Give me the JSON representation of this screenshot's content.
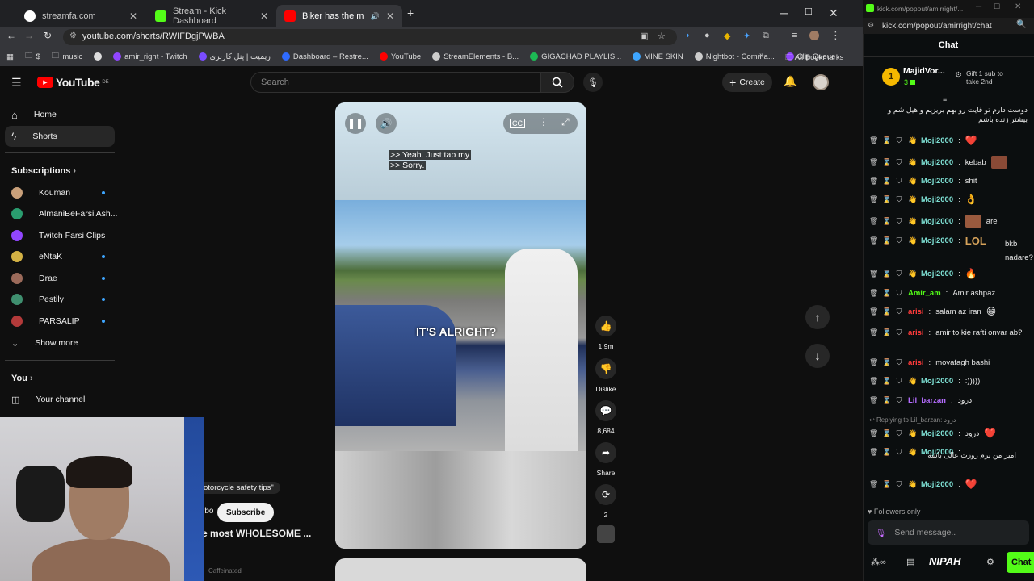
{
  "browser": {
    "tabs": [
      {
        "title": "streamfa.com",
        "favicon_color": "#4285f4"
      },
      {
        "title": "Stream - Kick Dashboard",
        "favicon_color": "#53fc18"
      },
      {
        "title": "Biker has the most WHOLE",
        "favicon_color": "#ff0000"
      }
    ],
    "url": "youtube.com/shorts/RWIFDgjPWBA",
    "bookmarks": [
      {
        "label": "$",
        "color": "#888"
      },
      {
        "label": "music",
        "color": "#888"
      },
      {
        "label": "amir_right - Twitch",
        "color": "#9146ff"
      },
      {
        "label": "ریمیت | پنل کاربری",
        "color": "#7a4cff"
      },
      {
        "label": "Dashboard – Restre...",
        "color": "#2f6bff"
      },
      {
        "label": "YouTube",
        "color": "#ff0000"
      },
      {
        "label": "StreamElements - B...",
        "color": "#cccccc"
      },
      {
        "label": "GIGACHAD PLAYLIS...",
        "color": "#1db954"
      },
      {
        "label": "MINE SKIN",
        "color": "#3ea6ff"
      },
      {
        "label": "Nightbot - Comma...",
        "color": "#cccccc"
      },
      {
        "label": "Clip Queue",
        "color": "#9146ff"
      }
    ],
    "all_bookmarks": "All Bookmarks"
  },
  "youtube": {
    "logo_text": "YouTube",
    "logo_region": "DE",
    "search_placeholder": "Search",
    "create_label": "Create",
    "nav": [
      {
        "label": "Home",
        "icon": "home-icon"
      },
      {
        "label": "Shorts",
        "icon": "shorts-icon"
      }
    ],
    "subscriptions_title": "Subscriptions",
    "subscriptions": [
      {
        "name": "Kouman",
        "live": true,
        "color": "#c9a07a"
      },
      {
        "name": "AlmaniBeFarsi Ash...",
        "live": false,
        "color": "#2a9d6f"
      },
      {
        "name": "Twitch Farsi Clips",
        "live": false,
        "color": "#9146ff"
      },
      {
        "name": "eNtaK",
        "live": true,
        "color": "#d4b245"
      },
      {
        "name": "Drae",
        "live": true,
        "color": "#9b6a5a"
      },
      {
        "name": "Pestily",
        "live": true,
        "color": "#3f8f6f"
      },
      {
        "name": "PARSALIP",
        "live": true,
        "color": "#b33a3a"
      }
    ],
    "show_more": "Show more",
    "you_title": "You",
    "your_channel": "Your channel",
    "short": {
      "caption_line1": ">> Yeah. Just tap my",
      "caption_line2": ">> Sorry.",
      "overlay_text": "IT'S ALRIGHT?",
      "likes": "1.9m",
      "dislike_label": "Dislike",
      "comments": "8,684",
      "share_label": "Share",
      "remix_count": "2",
      "desc_tag": "otorcycle safety tips\"",
      "channel_frag": "rbo",
      "subscribe_label": "Subscribe",
      "title_frag": "e most WHOLESOME ..."
    },
    "footer_frag": "Caffeinated"
  },
  "kick": {
    "window_url": "kick.com/popout/amirright/...",
    "address": "kick.com/popout/amirright/chat",
    "header": "Chat",
    "top_gifter": {
      "name": "MajidVor...",
      "count": "3",
      "gift_label": "Gift 1 sub to take 2nd"
    },
    "messages": [
      {
        "user": "",
        "user_color": "#e8e8e8",
        "text": "دوست دارم تو فایت رو بهم بریزیم و هیل شم و بیشتر زنده باشم",
        "emote": ""
      },
      {
        "user": "Moji2000",
        "user_color": "#7ee0d4",
        "text": "",
        "emote": "❤️"
      },
      {
        "user": "Moji2000",
        "user_color": "#7ee0d4",
        "text": "kebab",
        "emote": "face"
      },
      {
        "user": "Moji2000",
        "user_color": "#7ee0d4",
        "text": "shit",
        "emote": ""
      },
      {
        "user": "Moji2000",
        "user_color": "#7ee0d4",
        "text": "",
        "emote": "👌"
      },
      {
        "user": "Moji2000",
        "user_color": "#7ee0d4",
        "text": "are",
        "emote": "face"
      },
      {
        "user": "Moji2000",
        "user_color": "#7ee0d4",
        "text": "bkb nadare?",
        "emote": "LOL"
      },
      {
        "user": "Moji2000",
        "user_color": "#7ee0d4",
        "text": "",
        "emote": "🔥"
      },
      {
        "user": "Amir_am",
        "user_color": "#53fc18",
        "text": "Amir ashpaz",
        "emote": ""
      },
      {
        "user": "arisi",
        "user_color": "#ff3b3b",
        "text": "salam az iran",
        "emote": "😁"
      },
      {
        "user": "arisi",
        "user_color": "#ff3b3b",
        "text": "amir to kie rafti onvar ab?",
        "emote": ""
      },
      {
        "user": "arisi",
        "user_color": "#ff3b3b",
        "text": "movafagh bashi",
        "emote": ""
      },
      {
        "user": "Moji2000",
        "user_color": "#7ee0d4",
        "text": ":)))))",
        "emote": ""
      },
      {
        "user": "Lil_barzan",
        "user_color": "#b56cff",
        "text": "درود",
        "emote": ""
      },
      {
        "user": "Moji2000",
        "user_color": "#7ee0d4",
        "text": "درود",
        "emote": "❤️",
        "reply": "Replying to Lil_barzan: درود"
      },
      {
        "user": "Moji2000",
        "user_color": "#7ee0d4",
        "text": "امیر من برم روزت عالی باشه",
        "emote": ""
      },
      {
        "user": "Moji2000",
        "user_color": "#7ee0d4",
        "text": "",
        "emote": "❤️"
      }
    ],
    "followers_only": "Followers only",
    "input_placeholder": "Send message..",
    "send_label": "Chat",
    "bottom_brand": "NIPAH"
  }
}
